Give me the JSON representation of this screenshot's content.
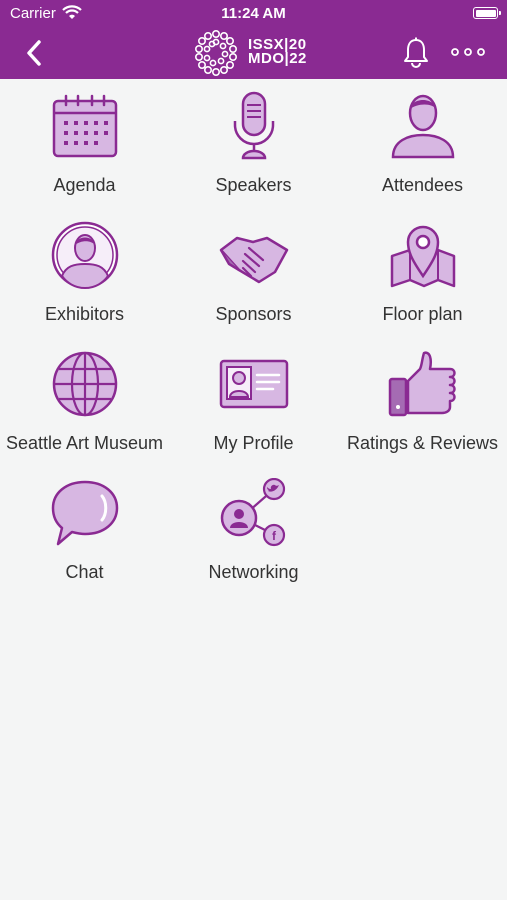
{
  "status_bar": {
    "carrier": "Carrier",
    "time": "11:24 AM"
  },
  "header": {
    "logo_line1": "ISSX|20",
    "logo_line2": "MDO|22"
  },
  "colors": {
    "header_bg": "#8a2a92",
    "icon_fill": "#d7b7e2",
    "icon_stroke": "#8a2a92"
  },
  "tiles": [
    {
      "label": "Agenda",
      "icon": "calendar-icon"
    },
    {
      "label": "Speakers",
      "icon": "microphone-icon"
    },
    {
      "label": "Attendees",
      "icon": "person-icon"
    },
    {
      "label": "Exhibitors",
      "icon": "person-circle-icon"
    },
    {
      "label": "Sponsors",
      "icon": "handshake-icon"
    },
    {
      "label": "Floor plan",
      "icon": "map-pin-icon"
    },
    {
      "label": "Seattle Art Museum",
      "icon": "globe-icon"
    },
    {
      "label": "My Profile",
      "icon": "id-card-icon"
    },
    {
      "label": "Ratings & Reviews",
      "icon": "thumbs-up-icon"
    },
    {
      "label": "Chat",
      "icon": "chat-bubble-icon"
    },
    {
      "label": "Networking",
      "icon": "social-network-icon"
    }
  ]
}
